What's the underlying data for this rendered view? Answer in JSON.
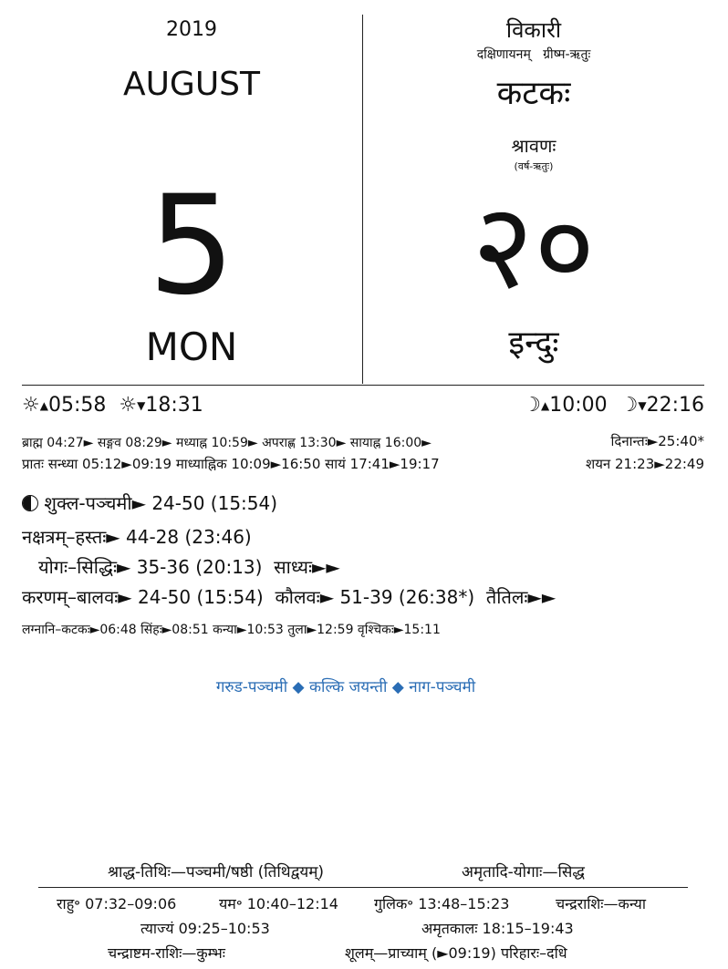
{
  "left": {
    "year": "2019",
    "month": "AUGUST",
    "day": "5",
    "weekday": "MON"
  },
  "right": {
    "samvatsara": "विकारी",
    "ayana_ritu": "दक्षिणायनम्   ग्रीष्म-ऋतुः",
    "solar_month": "कटकः",
    "lunar_month": "श्रावणः",
    "lunar_ritu": "(वर्ष-ऋतुः)",
    "solar_day": "२०",
    "vara": "इन्दुः"
  },
  "sun_moon": {
    "sunrise": "05:58",
    "sunset": "18:31",
    "moonrise": "10:00",
    "moonset": "22:16"
  },
  "day_parts": {
    "line1": "ब्राह्म 04:27► सङ्गव 08:29► मध्याह्न 10:59► अपराह्ण 13:30► सायाह्न 16:00►",
    "dinanta": "दिनान्तः►25:40*",
    "line2": "प्रातः सन्ध्या 05:12►09:19 माध्याह्निक 10:09►16:50 सायं 17:41►19:17",
    "shayana": "शयन 21:23►22:49"
  },
  "panchanga": {
    "tithi": "शुक्ल-पञ्चमी► 24-50 (15:54)",
    "nakshatra": "नक्षत्रम्–हस्तः► 44-28 (23:46)",
    "yoga": "योगः–सिद्धिः► 35-36 (20:13)  साध्यः►►",
    "karana": "करणम्–बालवः► 24-50 (15:54)  कौलवः► 51-39 (26:38*)  तैतिलः►►",
    "lagna": "लग्नानि–कटकः►06:48 सिंहः►08:51 कन्या►10:53 तुला►12:59 वृश्चिकः►15:11"
  },
  "festivals": "गरुड-पञ्चमी ◆ कल्कि जयन्ती ◆ नाग-पञ्चमी",
  "footer": {
    "shraddha": "श्राद्ध-तिथिः—पञ्चमी/षष्ठी (तिथिद्वयम्)",
    "amritadi": "अमृतादि-योगाः—सिद्ध",
    "rahu": "राहु॰ 07:32–09:06",
    "yama": "यम॰ 10:40–12:14",
    "gulika": "गुलिक॰ 13:48–15:23",
    "chandra_rashi": "चन्द्रराशिः—कन्या",
    "tyajya": "त्याज्यं 09:25–10:53",
    "amrita_kala": "अमृतकालः 18:15–19:43",
    "chandrashtama": "चन्द्राष्टम-राशिः—कुम्भः",
    "shulam": "शूलम्—प्राच्याम् (►09:19) परिहारः–दधि"
  }
}
